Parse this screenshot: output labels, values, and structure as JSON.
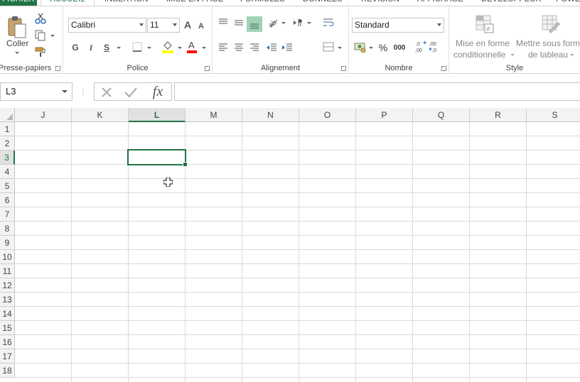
{
  "tabs": {
    "file": "FICHIER",
    "items": [
      "ACCUEIL",
      "INSERTION",
      "MISE EN PAGE",
      "FORMULES",
      "DONNÉES",
      "RÉVISION",
      "AFFICHAGE",
      "DÉVELOPPEUR",
      "POWE"
    ]
  },
  "clipboard": {
    "paste": "Coller",
    "label": "Presse-papiers"
  },
  "font": {
    "name": "Calibri",
    "size": "11",
    "bold": "G",
    "italic": "I",
    "underline": "S",
    "label": "Police",
    "grow": "A",
    "shrink": "A"
  },
  "alignment": {
    "label": "Alignement"
  },
  "number": {
    "format": "Standard",
    "percent": "%",
    "thousands": "000",
    "label": "Nombre"
  },
  "style": {
    "cond_line1": "Mise en forme",
    "cond_line2": "conditionnelle",
    "table_line1": "Mettre sous form",
    "table_line2": "de tableau",
    "label": "Style"
  },
  "formula_bar": {
    "name_box": "L3",
    "fx": "fx",
    "value": ""
  },
  "grid": {
    "columns": [
      "J",
      "K",
      "L",
      "M",
      "N",
      "O",
      "P",
      "Q",
      "R",
      "S"
    ],
    "rows": [
      "1",
      "2",
      "3",
      "4",
      "5",
      "6",
      "7",
      "8",
      "9",
      "10",
      "11",
      "12",
      "13",
      "14",
      "15",
      "16",
      "17",
      "18"
    ],
    "selected_column": "L",
    "selected_row": "3"
  },
  "colors": {
    "accent": "#217346",
    "fill_highlight": "#ffff00",
    "font_color": "#ff0000"
  }
}
